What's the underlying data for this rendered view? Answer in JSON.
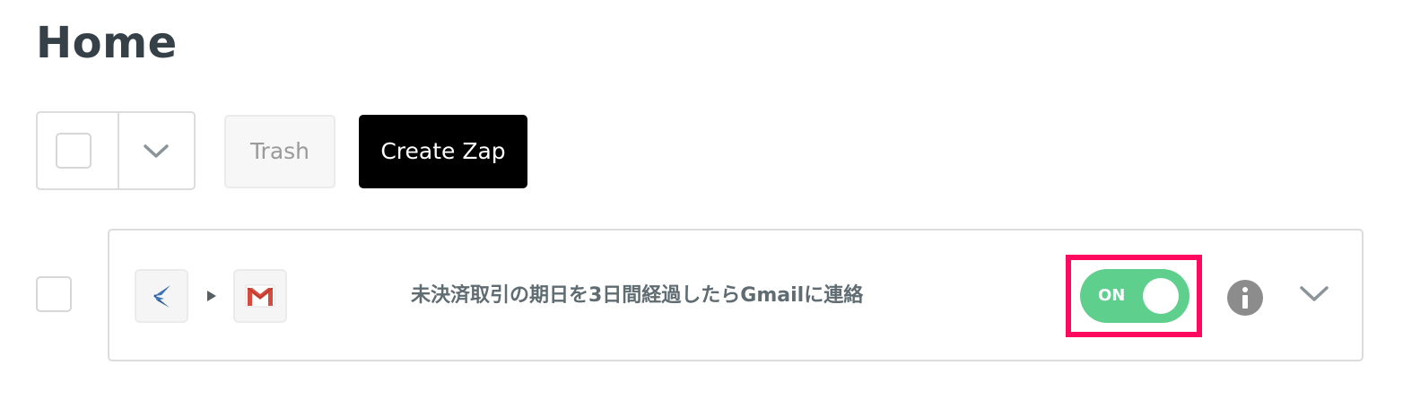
{
  "page": {
    "title": "Home"
  },
  "toolbar": {
    "trash_label": "Trash",
    "create_label": "Create Zap"
  },
  "zap": {
    "name": "未決済取引の期日を3日間経過したらGmailに連絡",
    "toggle_label": "ON",
    "enabled": true,
    "trigger_icon": "swallow-bird-icon",
    "action_icon": "gmail-icon"
  },
  "colors": {
    "toggle_on": "#5fcf8e",
    "highlight": "#ff0a5f",
    "create_button": "#000000",
    "title_text": "#354146"
  }
}
